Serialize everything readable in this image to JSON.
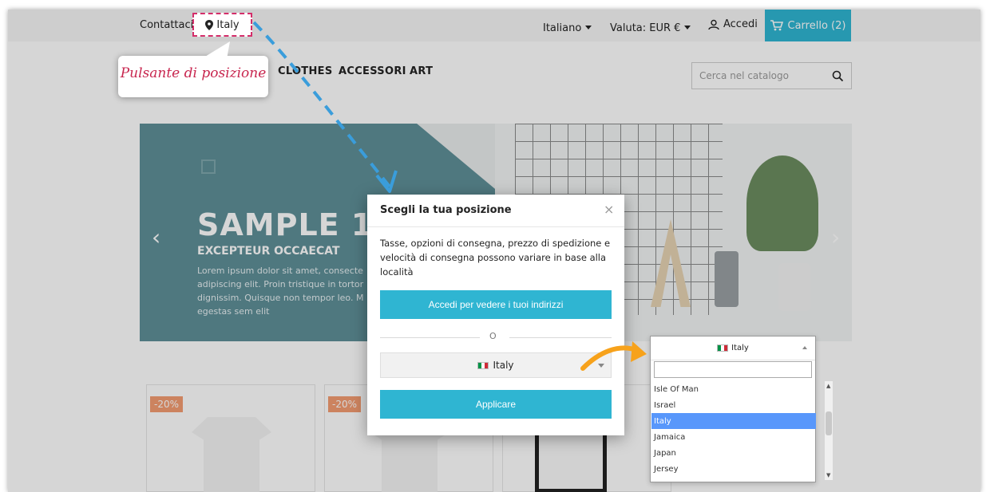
{
  "header": {
    "contact_label": "Contattaci",
    "location_label": "Italy",
    "language_label": "Italiano",
    "currency_label": "Valuta: EUR €",
    "login_label": "Accedi",
    "cart_label": "Carrello (2)"
  },
  "nav": {
    "items": [
      "CLOTHES",
      "ACCESSORI",
      "ART"
    ]
  },
  "search": {
    "placeholder": "Cerca nel catalogo"
  },
  "slider": {
    "title": "SAMPLE 1",
    "subtitle": "EXCEPTEUR OCCAECAT",
    "body": "Lorem ipsum dolor sit amet, consecte\nadipiscing elit. Proin tristique in tortor\ndignissim. Quisque non tempor leo. M\negestas sem elit"
  },
  "products": {
    "badges": [
      "-20%",
      "-20%"
    ]
  },
  "annotation": {
    "callout": "Pulsante di posizione"
  },
  "modal": {
    "title": "Scegli la tua posizione",
    "description": "Tasse, opzioni di consegna, prezzo di spedizione e velocità di consegna possono variare in base alla località",
    "login_button": "Accedi per vedere i tuoi indirizzi",
    "or_label": "O",
    "selected_country": "Italy",
    "apply_button": "Applicare"
  },
  "dropdown": {
    "selected": "Italy",
    "search_value": "",
    "options": [
      "Isle Of Man",
      "Israel",
      "Italy",
      "Jamaica",
      "Japan",
      "Jersey"
    ],
    "selected_index": 2
  },
  "colors": {
    "primary": "#2fb5d2",
    "discount": "#f39d72",
    "highlight": "#5897fb",
    "annotation": "#d42e6a",
    "arrow_blue": "#3a9ddb",
    "arrow_orange": "#f7a21b"
  }
}
